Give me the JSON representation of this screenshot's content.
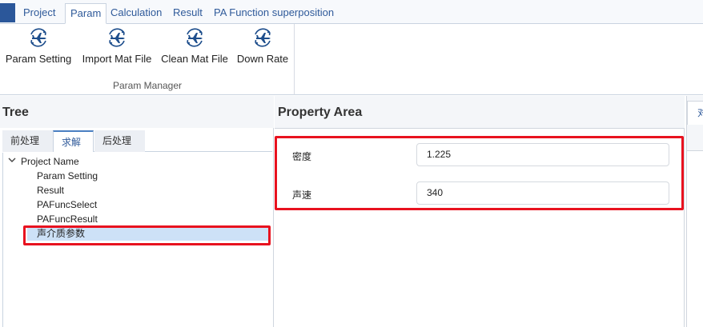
{
  "menu": {
    "tabs": [
      {
        "label": "Project"
      },
      {
        "label": "Param"
      },
      {
        "label": "Calculation"
      },
      {
        "label": "Result"
      },
      {
        "label": "PA Function superposition"
      }
    ],
    "active_tab": "Param"
  },
  "ribbon": {
    "buttons": [
      {
        "label": "Param Setting",
        "icon": "airplane-cycle-icon"
      },
      {
        "label": "Import Mat File",
        "icon": "airplane-cycle-icon"
      },
      {
        "label": "Clean Mat File",
        "icon": "airplane-cycle-icon"
      },
      {
        "label": "Down Rate",
        "icon": "airplane-cycle-icon"
      }
    ],
    "group_label": "Param Manager"
  },
  "tree_panel": {
    "title": "Tree",
    "tabs": [
      {
        "label": "前处理"
      },
      {
        "label": "求解"
      },
      {
        "label": "后处理"
      }
    ],
    "active_tab": "求解",
    "root": {
      "label": "Project Name",
      "expanded": true
    },
    "children": [
      {
        "label": "Param Setting"
      },
      {
        "label": "Result"
      },
      {
        "label": "PAFuncSelect"
      },
      {
        "label": "PAFuncResult"
      },
      {
        "label": "声介质参数",
        "selected": true
      }
    ]
  },
  "property_panel": {
    "title": "Property Area",
    "fields": [
      {
        "label": "密度",
        "value": "1.225"
      },
      {
        "label": "声速",
        "value": "340"
      }
    ]
  },
  "right_panel": {
    "tab_label": "对"
  },
  "colors": {
    "accent": "#2f5a9a",
    "app_button": "#2b579a",
    "highlight": "#e8121f",
    "selection": "#cde1f7"
  }
}
